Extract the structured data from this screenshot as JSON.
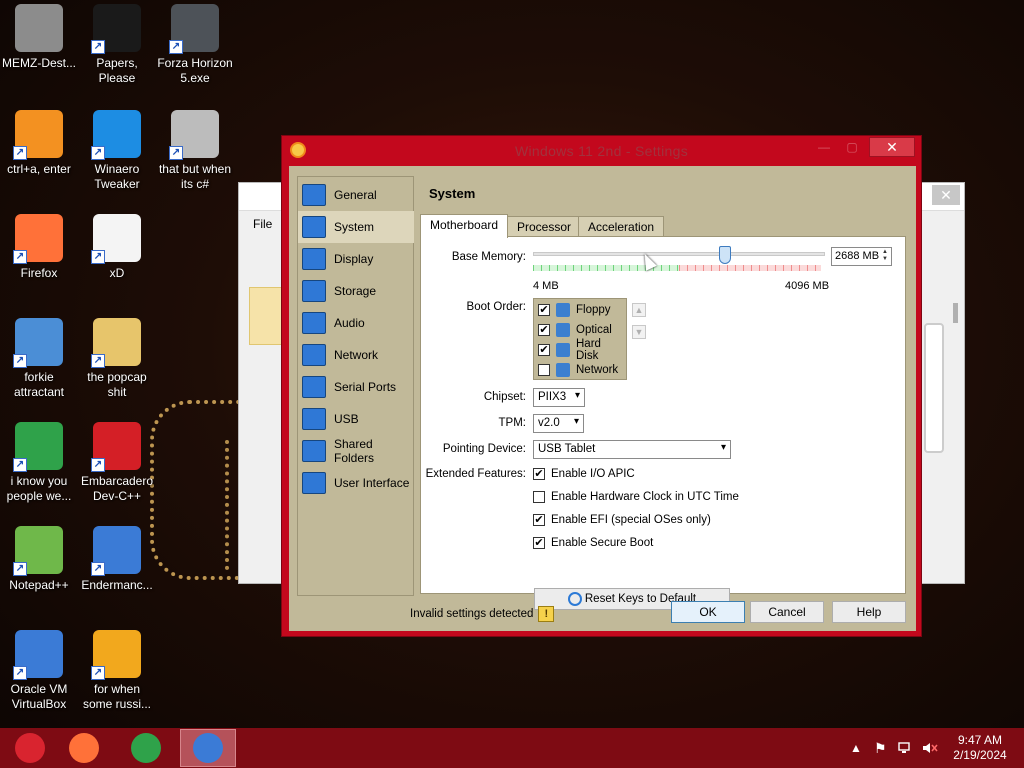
{
  "desktop": {
    "icons": [
      {
        "label": "MEMZ-Dest...",
        "icon": "recycle-bin-icon",
        "color": "#8c8c8c"
      },
      {
        "label": "Papers, Please",
        "icon": "papers-please-icon",
        "color": "#1a1a1a"
      },
      {
        "label": "Forza Horizon 5.exe",
        "icon": "flash-player-icon",
        "color": "#4d5258"
      },
      {
        "label": "ctrl+a, enter",
        "icon": "orange-ring-icon",
        "color": "#f39121"
      },
      {
        "label": "Winaero Tweaker",
        "icon": "winaero-icon",
        "color": "#1d8de3"
      },
      {
        "label": "that but when its c#",
        "icon": "windows-copies-icon",
        "color": "#bcbcbc"
      },
      {
        "label": "Firefox",
        "icon": "firefox-icon",
        "color": "#ff7139"
      },
      {
        "label": "xD",
        "icon": "hxd-icon",
        "color": "#f4f4f4"
      },
      {
        "label": "forkie attractant",
        "icon": "monitor-gear-icon",
        "color": "#4b8ed6"
      },
      {
        "label": "the popcap shit",
        "icon": "folder-icon",
        "color": "#e7c56b"
      },
      {
        "label": "i know you people we...",
        "icon": "chrome-icon",
        "color": "#2fa24a"
      },
      {
        "label": "Embarcadero Dev-C++",
        "icon": "devcpp-icon",
        "color": "#d41f26"
      },
      {
        "label": "Notepad++",
        "icon": "notepad-plus-plus-icon",
        "color": "#6fb84a"
      },
      {
        "label": "Endermanc...",
        "icon": "document-window-icon",
        "color": "#3b7bd6"
      },
      {
        "label": "Oracle VM VirtualBox",
        "icon": "virtualbox-icon",
        "color": "#3b7bd6"
      },
      {
        "label": "for when some russi...",
        "icon": "delphi-de-icon",
        "color": "#f2a81d"
      }
    ]
  },
  "manager_window": {
    "menu_file": "File",
    "close_glyph": "✕"
  },
  "dialog": {
    "title": "Windows 11 2nd - Settings",
    "close_glyph": "✕",
    "minimize_glyph": "—",
    "maximize_glyph": "▢",
    "sidebar": [
      {
        "label": "General",
        "active": false
      },
      {
        "label": "System",
        "active": true
      },
      {
        "label": "Display",
        "active": false
      },
      {
        "label": "Storage",
        "active": false
      },
      {
        "label": "Audio",
        "active": false
      },
      {
        "label": "Network",
        "active": false
      },
      {
        "label": "Serial Ports",
        "active": false
      },
      {
        "label": "USB",
        "active": false
      },
      {
        "label": "Shared Folders",
        "active": false
      },
      {
        "label": "User Interface",
        "active": false
      }
    ],
    "panel_title": "System",
    "tabs": [
      "Motherboard",
      "Processor",
      "Acceleration"
    ],
    "base_memory": {
      "label": "Base Memory:",
      "value": "2688 MB",
      "min_label": "4 MB",
      "max_label": "4096 MB",
      "fraction": 0.656
    },
    "boot_order": {
      "label": "Boot Order:",
      "items": [
        {
          "label": "Floppy",
          "checked": true
        },
        {
          "label": "Optical",
          "checked": true
        },
        {
          "label": "Hard Disk",
          "checked": true
        },
        {
          "label": "Network",
          "checked": false
        }
      ],
      "up_glyph": "▲",
      "down_glyph": "▼"
    },
    "chipset": {
      "label": "Chipset:",
      "value": "PIIX3"
    },
    "tpm": {
      "label": "TPM:",
      "value": "v2.0"
    },
    "pointing_device": {
      "label": "Pointing Device:",
      "value": "USB Tablet"
    },
    "extended_features": {
      "label": "Extended Features:",
      "items": [
        {
          "label": "Enable I/O APIC",
          "checked": true
        },
        {
          "label": "Enable Hardware Clock in UTC Time",
          "checked": false
        },
        {
          "label": "Enable EFI (special OSes only)",
          "checked": true
        },
        {
          "label": "Enable Secure Boot",
          "checked": true
        }
      ]
    },
    "reset_keys_label": "Reset Keys to Default",
    "invalid_settings": "Invalid settings detected",
    "warning_glyph": "!",
    "buttons": {
      "ok": "OK",
      "cancel": "Cancel",
      "help": "Help"
    },
    "check_glyph": "✔",
    "dropdown_glyph": "▾"
  },
  "taskbar": {
    "apps": [
      {
        "name": "start",
        "icon": "start-orb-icon",
        "color": "#d9242f"
      },
      {
        "name": "firefox",
        "icon": "firefox-icon",
        "color": "#ff7139"
      },
      {
        "name": "chrome",
        "icon": "chrome-icon",
        "color": "#2fa24a"
      },
      {
        "name": "virtualbox",
        "icon": "virtualbox-icon",
        "color": "#3b7bd6"
      }
    ],
    "tray_chevron": "▲",
    "tray_flag": "⚑",
    "clock_time": "9:47 AM",
    "clock_date": "2/19/2024"
  }
}
